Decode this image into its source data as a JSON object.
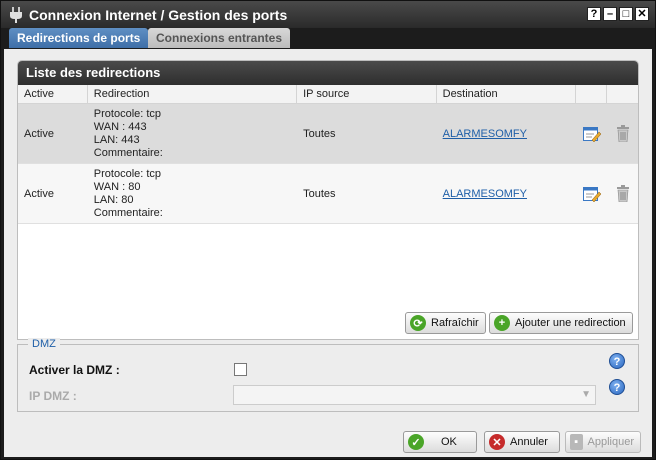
{
  "window": {
    "title": "Connexion Internet / Gestion des ports",
    "controls": {
      "help": "?",
      "minimize": "–",
      "maximize": "□",
      "close": "✕"
    }
  },
  "tabs": [
    {
      "label": "Redirections de ports",
      "active": true
    },
    {
      "label": "Connexions entrantes",
      "active": false
    }
  ],
  "list": {
    "title": "Liste des redirections",
    "columns": [
      "Active",
      "Redirection",
      "IP source",
      "Destination"
    ],
    "rows": [
      {
        "active": "Active",
        "protocol": "Protocole: tcp",
        "wan": "WAN : 443",
        "lan": "LAN: 443",
        "comment": "Commentaire:",
        "ip_source": "Toutes",
        "destination": "ALARMESOMFY"
      },
      {
        "active": "Active",
        "protocol": "Protocole: tcp",
        "wan": "WAN : 80",
        "lan": "LAN: 80",
        "comment": "Commentaire:",
        "ip_source": "Toutes",
        "destination": "ALARMESOMFY"
      }
    ]
  },
  "actions": {
    "refresh": "Rafraîchir",
    "add": "Ajouter une redirection"
  },
  "dmz": {
    "legend": "DMZ",
    "enable_label": "Activer la DMZ :",
    "ip_label": "IP DMZ :",
    "enable_checked": false,
    "ip_value": ""
  },
  "footer": {
    "ok": "OK",
    "cancel": "Annuler",
    "apply": "Appliquer"
  },
  "colors": {
    "active_tab": "#4f7fb6",
    "link": "#1f5fa8",
    "ok_green": "#4aa528",
    "cancel_red": "#c62b2b"
  }
}
